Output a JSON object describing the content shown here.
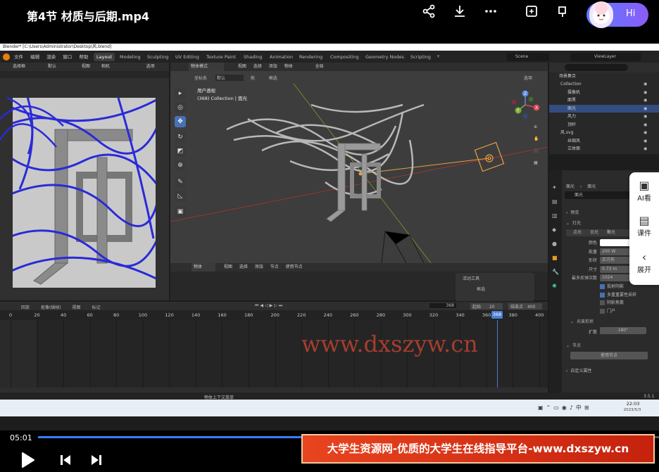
{
  "player": {
    "title": "第4节 材质与后期.mp4",
    "hi_label": "Hi",
    "current_time": "05:01",
    "progress_fraction": 0.455
  },
  "blender": {
    "window_title": "Blender* [C:\\Users\\Administrator\\Desktop\\风.blend]",
    "menus": [
      "文件",
      "编辑",
      "渲染",
      "窗口",
      "帮助"
    ],
    "workspace_tabs": [
      "Layout",
      "Modeling",
      "Sculpting",
      "UV Editing",
      "Texture Paint",
      "Shading",
      "Animation",
      "Rendering",
      "Compositing",
      "Geometry Nodes",
      "Scripting"
    ],
    "active_tab": "Layout",
    "scene_name": "Scene",
    "view_layer": "ViewLayer",
    "render_toolbar": [
      "选择框",
      "默认",
      "视图",
      "相机",
      "选项"
    ],
    "viewport": {
      "mode": "物体模式",
      "menus": [
        "视图",
        "选择",
        "添加",
        "物体"
      ],
      "transform": "全局",
      "options_label": "选项",
      "coord_label": "坐标系",
      "default_label": "默认",
      "drag_label": "拖",
      "select_label": "框选",
      "overlay_title": "用户透视",
      "overlay_collection": "(368) Collection | 面光",
      "axes": [
        "X",
        "Y",
        "Z"
      ]
    },
    "node_editor": {
      "object_label": "物体",
      "menus": [
        "视图",
        "选择",
        "添加",
        "节点"
      ],
      "use_nodes": "使用节点",
      "active_tool_title": "活动工具",
      "active_tool_item": "框选"
    },
    "timeline": {
      "menus": [
        "回放",
        "抠像(插帧)",
        "视图",
        "标记"
      ],
      "current_frame": "368",
      "start_label": "起始",
      "start": "20",
      "end_label": "结束点",
      "end": "400",
      "ticks": [
        "0",
        "20",
        "40",
        "60",
        "80",
        "100",
        "120",
        "140",
        "160",
        "180",
        "200",
        "220",
        "240",
        "260",
        "280",
        "300",
        "320",
        "340",
        "360",
        "380",
        "400"
      ],
      "playhead": "368"
    },
    "status_bar": "物体上下文菜单",
    "version": "3.5.1",
    "outliner": {
      "root": "场景集合",
      "items": [
        {
          "name": "Collection",
          "indent": 1
        },
        {
          "name": "摄像机",
          "indent": 2
        },
        {
          "name": "面黑",
          "indent": 2
        },
        {
          "name": "面光",
          "indent": 2,
          "selected": true
        },
        {
          "name": "风力",
          "indent": 2
        },
        {
          "name": "顶杆",
          "indent": 2
        },
        {
          "name": "风.svg",
          "indent": 1
        },
        {
          "name": "丝绸风",
          "indent": 2
        },
        {
          "name": "立体面",
          "indent": 2
        }
      ]
    },
    "properties": {
      "breadcrumb": [
        "面光",
        "面光"
      ],
      "data_name": "面光",
      "sections": [
        "预览",
        "灯光"
      ],
      "light_types": [
        "点光",
        "日光",
        "聚光",
        "面光"
      ],
      "fields": [
        {
          "label": "颜色",
          "value": ""
        },
        {
          "label": "能量",
          "value": "200 W"
        },
        {
          "label": "形状",
          "value": "正方形"
        },
        {
          "label": "尺寸",
          "value": "0.73 m"
        },
        {
          "label": "最多反弹次数",
          "value": "1024"
        }
      ],
      "checkboxes": [
        {
          "label": "投射阴影",
          "checked": true
        },
        {
          "label": "多重重要性采样",
          "checked": true
        },
        {
          "label": "阴影焦散",
          "checked": false
        },
        {
          "label": "门户",
          "checked": false
        }
      ],
      "beam_section": "光束形状",
      "spread_label": "扩散",
      "spread_value": "180°",
      "nodes_section": "节点",
      "use_nodes_button": "使用节点",
      "custom_props": "自定义属性"
    }
  },
  "taskbar": {
    "time": "22:03",
    "date": "2023/5/3"
  },
  "side_panel": {
    "items": [
      "AI看",
      "课件",
      "展开"
    ]
  },
  "watermark": "www.dxszyw.cn",
  "banner": "大学生资源网-优质的大学生在线指导平台-www.dxszyw.cn"
}
